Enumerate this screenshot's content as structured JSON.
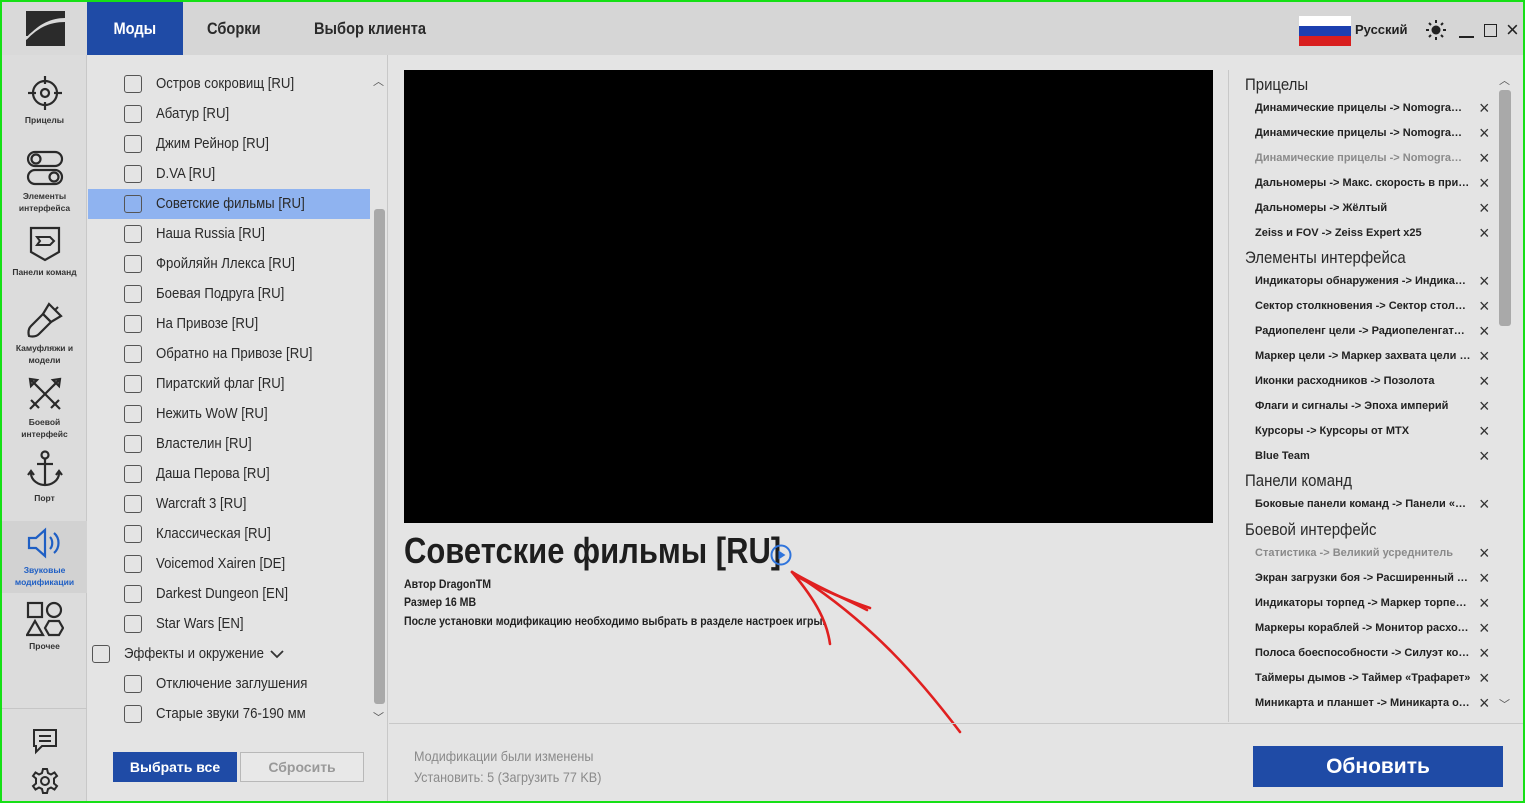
{
  "tabs": [
    {
      "label": "Моды"
    },
    {
      "label": "Сборки"
    },
    {
      "label": "Выбор клиента"
    }
  ],
  "language": "Русский",
  "colors": {
    "accent": "#1f4ba6",
    "selection": "#8fb3f0",
    "frame": "#16e016"
  },
  "nav": [
    {
      "label": "Прицелы",
      "icon": "crosshair-icon"
    },
    {
      "label": "Элементы интерфейса",
      "icon": "toggle-icon"
    },
    {
      "label": "Панели команд",
      "icon": "command-panel-icon"
    },
    {
      "label": "Камуфляжи и модели",
      "icon": "brush-icon"
    },
    {
      "label": "Боевой интерфейс",
      "icon": "crossed-swords-icon"
    },
    {
      "label": "Порт",
      "icon": "anchor-icon"
    },
    {
      "label": "Звуковые модификации",
      "icon": "speaker-icon"
    },
    {
      "label": "Прочее",
      "icon": "shapes-icon"
    }
  ],
  "mods": [
    {
      "label": "Остров сокровищ [RU]"
    },
    {
      "label": "Абатур [RU]"
    },
    {
      "label": "Джим Рейнор [RU]"
    },
    {
      "label": "D.VA [RU]"
    },
    {
      "label": "Советские фильмы [RU]"
    },
    {
      "label": "Наша Russia [RU]"
    },
    {
      "label": "Фройляйн Ллекса [RU]"
    },
    {
      "label": "Боевая Подруга [RU]"
    },
    {
      "label": "На Привозе [RU]"
    },
    {
      "label": "Обратно на Привозе [RU]"
    },
    {
      "label": "Пиратский флаг [RU]"
    },
    {
      "label": "Нежить WoW [RU]"
    },
    {
      "label": "Властелин [RU]"
    },
    {
      "label": "Даша Перова [RU]"
    },
    {
      "label": "Warcraft 3 [RU]"
    },
    {
      "label": "Классическая [RU]"
    },
    {
      "label": "Voicemod Xairen [DE]"
    },
    {
      "label": "Darkest Dungeon [EN]"
    },
    {
      "label": "Star Wars [EN]"
    },
    {
      "label": "Эффекты и окружение"
    },
    {
      "label": "Отключение заглушения"
    },
    {
      "label": "Старые звуки 76-190 мм"
    }
  ],
  "buttons": {
    "select_all": "Выбрать все",
    "reset": "Сбросить",
    "update": "Обновить"
  },
  "detail": {
    "title": "Советские фильмы [RU]",
    "author": "Автор DragonTM",
    "size": "Размер 16 MB",
    "note": "После установки модификацию необходимо выбрать в разделе настроек игры."
  },
  "summary": [
    {
      "title": "Прицелы",
      "items": [
        {
          "text": "Динамические прицелы -> Nomogram Mod..."
        },
        {
          "text": "Динамические прицелы -> Nomogram Mod..."
        },
        {
          "text": "Динамические прицелы -> Nomogram Stiv..."
        },
        {
          "text": "Дальномеры -> Макс. скорость в прицеле"
        },
        {
          "text": "Дальномеры -> Жёлтый"
        },
        {
          "text": "Zeiss и FOV -> Zeiss Expert x25"
        }
      ]
    },
    {
      "title": "Элементы интерфейса",
      "items": [
        {
          "text": "Индикаторы обнаружения -> Индикаторы..."
        },
        {
          "text": "Сектор столкновения -> Сектор столкнове..."
        },
        {
          "text": "Радиопеленг цели -> Радиопеленгатор Син..."
        },
        {
          "text": "Маркер цели -> Маркер захвата цели «Кра..."
        },
        {
          "text": "Иконки расходников -> Позолота"
        },
        {
          "text": "Флаги и сигналы -> Эпоха империй"
        },
        {
          "text": "Курсоры -> Курсоры от MTX"
        },
        {
          "text": "Blue Team"
        }
      ]
    },
    {
      "title": "Панели команд",
      "items": [
        {
          "text": "Боковые панели команд -> Панели «Tactic..."
        }
      ]
    },
    {
      "title": "Боевой интерфейс",
      "items": [
        {
          "text": "Статистика -> Великий усреднитель"
        },
        {
          "text": "Экран загрузки боя -> Расширенный экран..."
        },
        {
          "text": "Индикаторы торпед -> Маркер торпед ПЛ"
        },
        {
          "text": "Маркеры кораблей -> Монитор расходников"
        },
        {
          "text": "Полоса боеспособности -> Силуэт корабля"
        },
        {
          "text": "Таймеры дымов -> Таймер «Трафарет»"
        },
        {
          "text": "Миникарта и планшет -> Миникарта от Aut..."
        }
      ]
    }
  ],
  "status": {
    "changed": "Модификации были изменены",
    "install": "Установить: 5 (Загрузить 77 KB)"
  }
}
